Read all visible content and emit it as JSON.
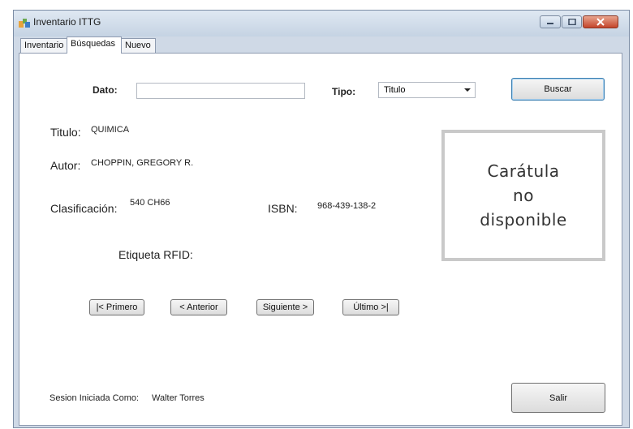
{
  "window": {
    "title": "Inventario ITTG"
  },
  "tabs": [
    {
      "label": "Inventario"
    },
    {
      "label": "Búsquedas"
    },
    {
      "label": "Nuevo"
    }
  ],
  "search": {
    "dato_label": "Dato:",
    "dato_value": "",
    "tipo_label": "Tipo:",
    "tipo_value": "Titulo",
    "buscar_label": "Buscar"
  },
  "book": {
    "titulo_label": "Titulo:",
    "titulo_value": "QUIMICA",
    "autor_label": "Autor:",
    "autor_value": "CHOPPIN, GREGORY R.",
    "clasificacion_label": "Clasificación:",
    "clasificacion_value": "540 CH66",
    "isbn_label": "ISBN:",
    "isbn_value": "968-439-138-2",
    "rfid_label": "Etiqueta RFID:",
    "cover_text": "Carátula\nno\ndisponible"
  },
  "nav": {
    "first": "|< Primero",
    "prev": "< Anterior",
    "next": "Siguiente >",
    "last": "Último >|"
  },
  "footer": {
    "session_label": "Sesion Iniciada Como:",
    "session_user": "Walter Torres",
    "exit_label": "Salir"
  }
}
